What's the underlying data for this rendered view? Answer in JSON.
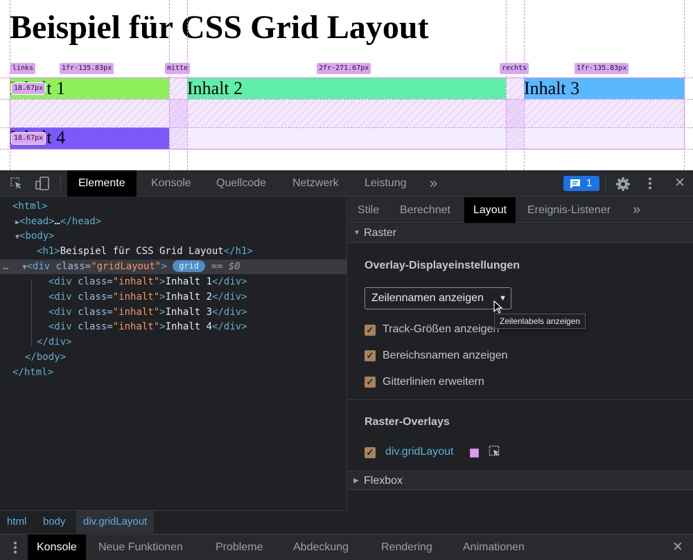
{
  "preview": {
    "heading": "Beispiel für CSS Grid Layout",
    "cells": [
      "Inhalt 1",
      "Inhalt 2",
      "Inhalt 3",
      "Inhalt 4"
    ],
    "column_name_labels": [
      "links",
      "mitte",
      "rechts"
    ],
    "track_size_labels": [
      "1fr·135.83px",
      "2fr·271.67px",
      "1fr·135.83px"
    ],
    "row_size_labels": [
      "18.67px",
      "18.67px"
    ],
    "grid_color": "#d79bf0"
  },
  "toolbar": {
    "tabs": [
      "Elemente",
      "Konsole",
      "Quellcode",
      "Netzwerk",
      "Leistung"
    ],
    "more": "»",
    "issues_count": "1",
    "close": "✕"
  },
  "dom_tree": {
    "html_open": "<html>",
    "head_tag": "<head>",
    "head_ellipsis": "…",
    "head_close": "</head>",
    "body_open": "<body>",
    "h1_open": "<h1>",
    "h1_text": "Beispiel für CSS Grid Layout",
    "h1_close": "</h1>",
    "div_open": "<div",
    "class_attr": "class=",
    "grid_class_value": "\"gridLayout\"",
    "tag_end": ">",
    "grid_badge": "grid",
    "dollar": "== $0",
    "inhalt_class_value": "\"inhalt\"",
    "children_text": [
      "Inhalt 1",
      "Inhalt 2",
      "Inhalt 3",
      "Inhalt 4"
    ],
    "div_close": "</div>",
    "body_close": "</body>",
    "html_close": "</html>",
    "ellipsis_marker": "…"
  },
  "breadcrumbs": [
    "html",
    "body",
    "div.gridLayout"
  ],
  "sidebar": {
    "tabs": [
      "Stile",
      "Berechnet",
      "Layout",
      "Ereignis-Listener"
    ],
    "more": "»",
    "raster_section": "Raster",
    "overlay_title": "Overlay-Displayeinstellungen",
    "select_value": "Zeilennamen anzeigen",
    "checkboxes": [
      "Track-Größen anzeigen",
      "Bereichsnamen anzeigen",
      "Gitterlinien erweitern"
    ],
    "tooltip": "Zeilenlabels anzeigen",
    "overlays_title": "Raster-Overlays",
    "overlay_item": "div.gridLayout",
    "flexbox_section": "Flexbox"
  },
  "drawer": {
    "tabs": [
      "Konsole",
      "Neue Funktionen",
      "Probleme",
      "Abdeckung",
      "Rendering",
      "Animationen"
    ],
    "close": "✕"
  }
}
